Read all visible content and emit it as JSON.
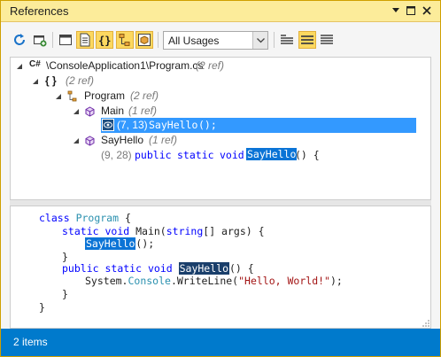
{
  "window": {
    "title": "References"
  },
  "toolbar": {
    "filter_selected": "All Usages",
    "icons": [
      "refresh-icon",
      "new-window-icon",
      "window-icon",
      "file-icon",
      "namespace-braces-icon",
      "class-hierarchy-icon",
      "class-box-icon",
      "group-list-icon",
      "group-list-active-icon",
      "group-flat-icon"
    ]
  },
  "tree": {
    "file": {
      "lang": "C#",
      "path": "\\ConsoleApplication1\\Program.cs",
      "refs": "(2 ref)"
    },
    "namespace": {
      "label": "{ }",
      "refs": "(2 ref)"
    },
    "class": {
      "label": "Program",
      "refs": "(2 ref)"
    },
    "method_main": {
      "label": "Main",
      "refs": "(1 ref)"
    },
    "main_usage": {
      "location": "(7, 13)",
      "highlight": "SayHello",
      "rest": "();"
    },
    "method_sayhello": {
      "label": "SayHello",
      "refs": "(1 ref)"
    },
    "sayhello_usage": {
      "location": "(9, 28)",
      "kw1": "public",
      "kw2": "static",
      "kw3": "void",
      "highlight": "SayHello",
      "rest": "() {"
    }
  },
  "code": {
    "line1": {
      "kw": "class",
      "type": "Program",
      "rest": " {"
    },
    "line2": {
      "kw1": "static",
      "kw2": "void",
      "rest": " Main(",
      "kw3": "string",
      "rest2": "[] args) {"
    },
    "line3": {
      "highlight": "SayHello",
      "rest": "();"
    },
    "line4": {
      "text": "}"
    },
    "line5": {
      "kw1": "public",
      "kw2": "static",
      "kw3": "void",
      "highlight": "SayHello",
      "rest": "() {"
    },
    "line6": {
      "pre": "System.",
      "type": "Console",
      "mid": ".WriteLine(",
      "str": "\"Hello, World!\"",
      "post": ");"
    },
    "line7": {
      "text": "}"
    },
    "line8": {
      "text": "}"
    }
  },
  "status": {
    "text": "2 items"
  },
  "colors": {
    "title_bar": "#fcec9a",
    "selection": "#3399ff",
    "status_bar": "#007acc",
    "keyword": "#0000ff",
    "type": "#2b91af",
    "string": "#a31515"
  }
}
